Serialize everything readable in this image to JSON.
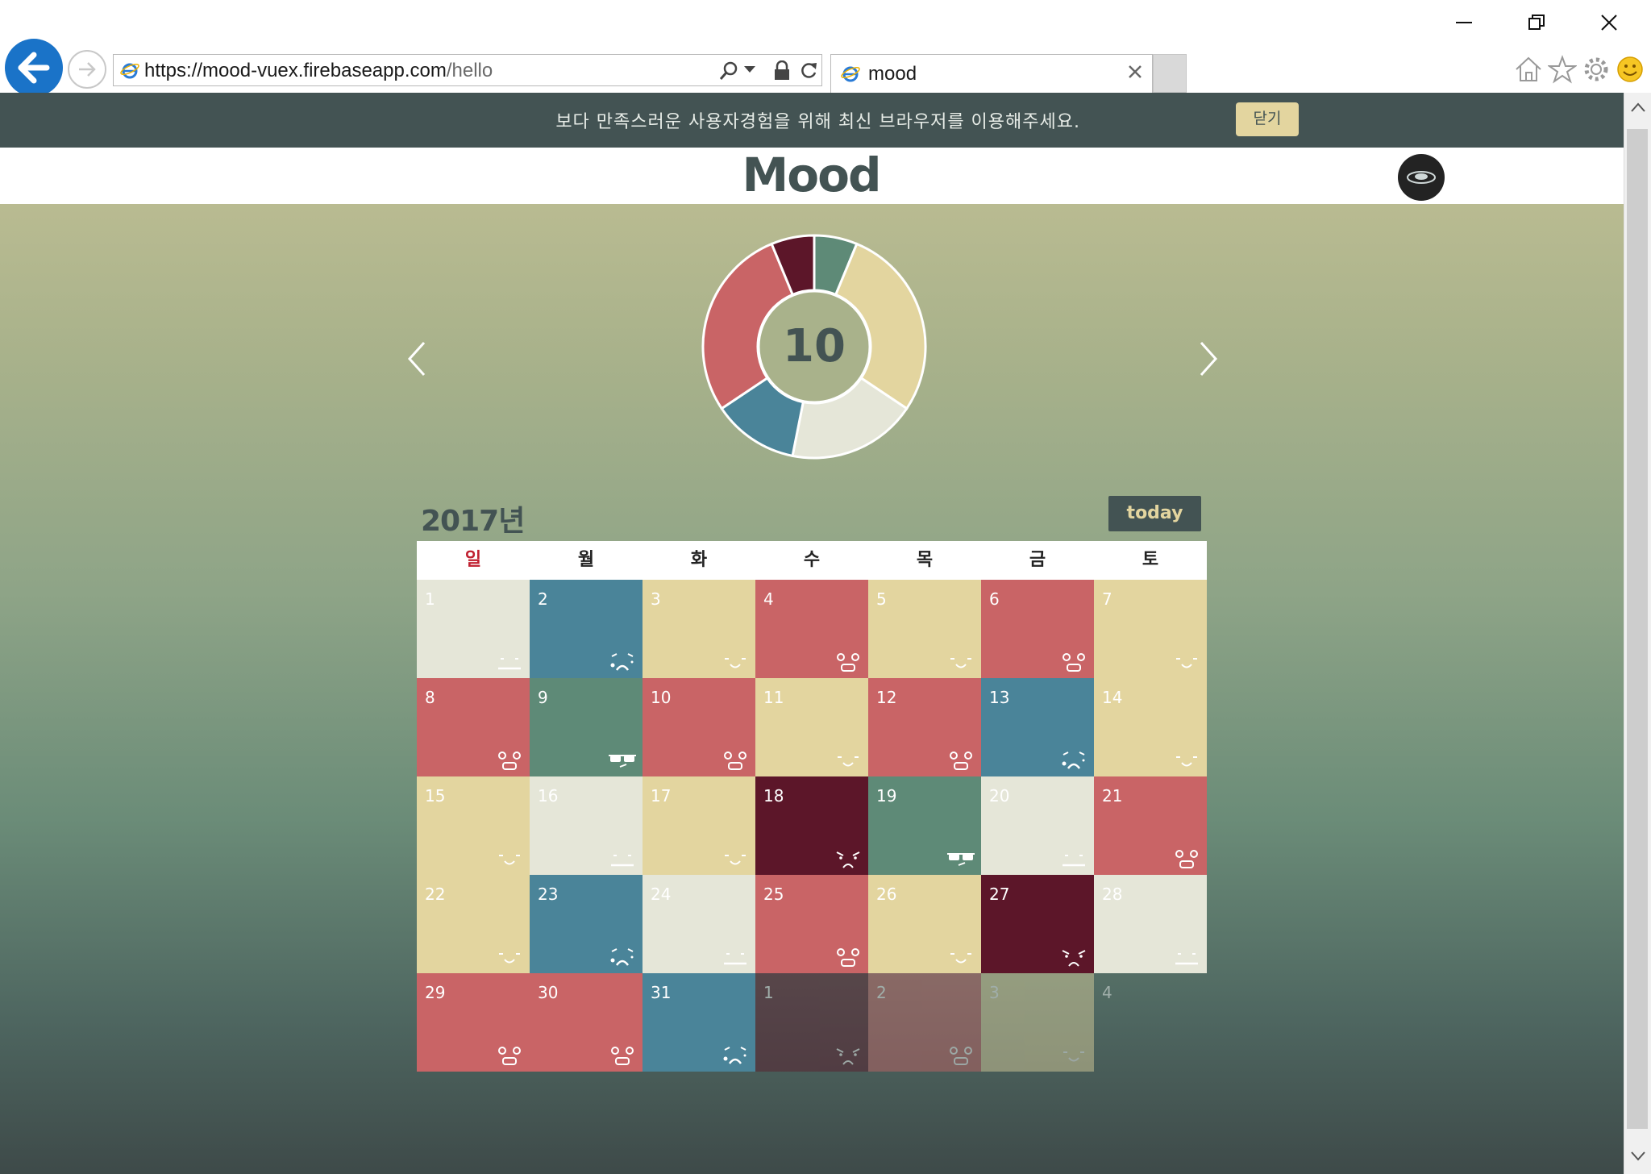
{
  "browser": {
    "url_host": "https://mood-vuex.firebaseapp.com",
    "url_path": "/hello",
    "tab_title": "mood",
    "icons": [
      "back-icon",
      "forward-icon",
      "search-icon",
      "lock-icon",
      "refresh-icon",
      "home-icon",
      "favorites-star-icon",
      "settings-gear-icon",
      "smiley-feedback-icon"
    ]
  },
  "banner": {
    "message": "보다 만족스러운 사용자경험을 위해 최신 브라우저를 이용해주세요.",
    "close_label": "닫기"
  },
  "header": {
    "logo_text": "Mood"
  },
  "chart_data": {
    "type": "pie",
    "center_label": "10",
    "slices": [
      {
        "mood": "cool",
        "color": "#5e8a77",
        "value": 2
      },
      {
        "mood": "happy",
        "color": "#e3d59f",
        "value": 9
      },
      {
        "mood": "calm",
        "color": "#e5e6d8",
        "value": 6
      },
      {
        "mood": "sad",
        "color": "#4a8499",
        "value": 4
      },
      {
        "mood": "surprised",
        "color": "#c96466",
        "value": 9
      },
      {
        "mood": "angry",
        "color": "#5c1629",
        "value": 2
      }
    ]
  },
  "calendar": {
    "year_label": "2017년",
    "today_label": "today",
    "weekdays": [
      "일",
      "월",
      "화",
      "수",
      "목",
      "금",
      "토"
    ],
    "colors": {
      "calm": "#e5e6d8",
      "sad": "#4a8499",
      "happy": "#e3d59f",
      "surprised": "#c96466",
      "cool": "#5e8a77",
      "angry": "#5c1629"
    },
    "days": [
      {
        "n": "1",
        "mood": "calm"
      },
      {
        "n": "2",
        "mood": "sad"
      },
      {
        "n": "3",
        "mood": "happy"
      },
      {
        "n": "4",
        "mood": "surprised"
      },
      {
        "n": "5",
        "mood": "happy"
      },
      {
        "n": "6",
        "mood": "surprised"
      },
      {
        "n": "7",
        "mood": "happy"
      },
      {
        "n": "8",
        "mood": "surprised"
      },
      {
        "n": "9",
        "mood": "cool"
      },
      {
        "n": "10",
        "mood": "surprised"
      },
      {
        "n": "11",
        "mood": "happy"
      },
      {
        "n": "12",
        "mood": "surprised"
      },
      {
        "n": "13",
        "mood": "sad"
      },
      {
        "n": "14",
        "mood": "happy"
      },
      {
        "n": "15",
        "mood": "happy"
      },
      {
        "n": "16",
        "mood": "calm"
      },
      {
        "n": "17",
        "mood": "happy"
      },
      {
        "n": "18",
        "mood": "angry"
      },
      {
        "n": "19",
        "mood": "cool"
      },
      {
        "n": "20",
        "mood": "calm"
      },
      {
        "n": "21",
        "mood": "surprised"
      },
      {
        "n": "22",
        "mood": "happy"
      },
      {
        "n": "23",
        "mood": "sad"
      },
      {
        "n": "24",
        "mood": "calm"
      },
      {
        "n": "25",
        "mood": "surprised"
      },
      {
        "n": "26",
        "mood": "happy"
      },
      {
        "n": "27",
        "mood": "angry"
      },
      {
        "n": "28",
        "mood": "calm"
      },
      {
        "n": "29",
        "mood": "surprised"
      },
      {
        "n": "30",
        "mood": "surprised"
      },
      {
        "n": "31",
        "mood": "sad"
      },
      {
        "n": "1",
        "mood": "angry",
        "other": true
      },
      {
        "n": "2",
        "mood": "surprised",
        "other": true
      },
      {
        "n": "3",
        "mood": "happy",
        "other": true
      },
      {
        "n": "4",
        "mood": "none",
        "other": true
      }
    ]
  }
}
